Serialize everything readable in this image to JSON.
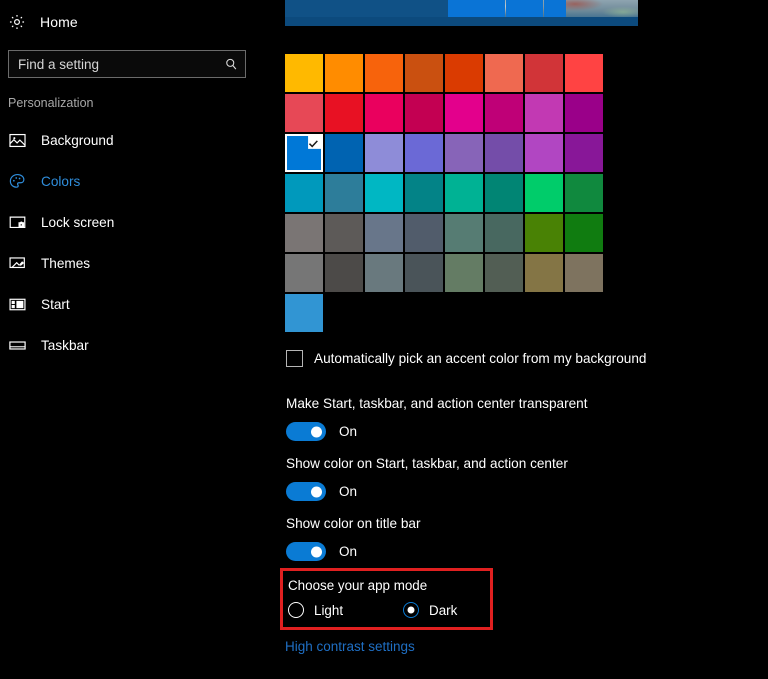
{
  "sidebar": {
    "home": {
      "label": "Home",
      "icon": "gear-icon"
    },
    "search": {
      "placeholder": "Find a setting",
      "value": "",
      "icon": "search-icon"
    },
    "section_title": "Personalization",
    "items": [
      {
        "label": "Background",
        "icon": "picture-icon",
        "active": false
      },
      {
        "label": "Colors",
        "icon": "palette-icon",
        "active": true
      },
      {
        "label": "Lock screen",
        "icon": "lock-screen-icon",
        "active": false
      },
      {
        "label": "Themes",
        "icon": "brush-icon",
        "active": false
      },
      {
        "label": "Start",
        "icon": "start-tiles-icon",
        "active": false
      },
      {
        "label": "Taskbar",
        "icon": "taskbar-icon",
        "active": false
      }
    ]
  },
  "main": {
    "accent_colors": {
      "selected_index": 16,
      "rows": [
        [
          "#ffb900",
          "#ff8c00",
          "#f7630c",
          "#ca5010",
          "#da3b01",
          "#ef6950",
          "#d13438",
          "#ff4343"
        ],
        [
          "#e74856",
          "#e81123",
          "#ea005e",
          "#c30052",
          "#e3008c",
          "#bf0077",
          "#c239b3",
          "#9a0089"
        ],
        [
          "#0078d7",
          "#0063b1",
          "#8e8cd8",
          "#6b69d6",
          "#8764b8",
          "#744da9",
          "#b146c2",
          "#881798"
        ],
        [
          "#0099bc",
          "#2d7d9a",
          "#00b7c3",
          "#038387",
          "#00b294",
          "#018574",
          "#00cc6a",
          "#10893e"
        ],
        [
          "#7a7574",
          "#5d5a58",
          "#68768a",
          "#515c6b",
          "#567c73",
          "#486860",
          "#498205",
          "#107c10"
        ],
        [
          "#767676",
          "#4c4a48",
          "#69797e",
          "#4a5459",
          "#647c64",
          "#525e54",
          "#847545",
          "#7e735f"
        ]
      ],
      "custom": "#3195d3"
    },
    "auto_accent": {
      "label": "Automatically pick an accent color from my background",
      "checked": false
    },
    "toggles": [
      {
        "label": "Make Start, taskbar, and action center transparent",
        "state": "On",
        "on": true
      },
      {
        "label": "Show color on Start, taskbar, and action center",
        "state": "On",
        "on": true
      },
      {
        "label": "Show color on title bar",
        "state": "On",
        "on": true
      }
    ],
    "app_mode": {
      "title": "Choose your app mode",
      "options": [
        {
          "label": "Light",
          "selected": false
        },
        {
          "label": "Dark",
          "selected": true
        }
      ],
      "highlight_color": "#e02020"
    },
    "high_contrast_link": "High contrast settings"
  },
  "theme": {
    "accent": "#0a7bd4",
    "link": "#1f6fc4",
    "active_nav": "#2f8ddb",
    "background": "#000000"
  }
}
